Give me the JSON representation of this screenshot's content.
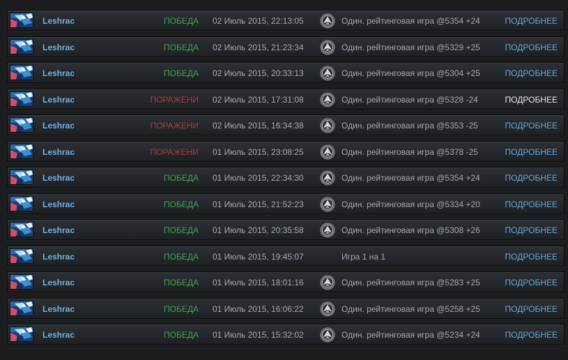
{
  "colors": {
    "win": "#3fa34d",
    "loss": "#b43a34",
    "hero_name": "#6fb2e6",
    "details_link": "#5fa9df",
    "details_link_hover": "#e8e9ea",
    "text_muted": "#a7a9ac"
  },
  "matches": [
    {
      "hero": "Leshrac",
      "hero_icon": "leshrac-portrait-icon",
      "result": "ПОБЕДА",
      "result_type": "win",
      "date": "02 Июль 2015, 22:13:05",
      "mode_icon": "ranked-icon",
      "mode": "Один. рейтинговая игра @5354 +24",
      "details": "ПОДРОБНЕЕ",
      "details_hover": false
    },
    {
      "hero": "Leshrac",
      "hero_icon": "leshrac-portrait-icon",
      "result": "ПОБЕДА",
      "result_type": "win",
      "date": "02 Июль 2015, 21:23:34",
      "mode_icon": "ranked-icon",
      "mode": "Один. рейтинговая игра @5329 +25",
      "details": "ПОДРОБНЕЕ",
      "details_hover": false
    },
    {
      "hero": "Leshrac",
      "hero_icon": "leshrac-portrait-icon",
      "result": "ПОБЕДА",
      "result_type": "win",
      "date": "02 Июль 2015, 20:33:13",
      "mode_icon": "ranked-icon",
      "mode": "Один. рейтинговая игра @5304 +25",
      "details": "ПОДРОБНЕЕ",
      "details_hover": false
    },
    {
      "hero": "Leshrac",
      "hero_icon": "leshrac-portrait-icon",
      "result": "ПОРАЖЕНИ",
      "result_type": "loss",
      "date": "02 Июль 2015, 17:31:08",
      "mode_icon": "ranked-icon",
      "mode": "Один. рейтинговая игра @5328 -24",
      "details": "ПОДРОБНЕЕ",
      "details_hover": true
    },
    {
      "hero": "Leshrac",
      "hero_icon": "leshrac-portrait-icon",
      "result": "ПОРАЖЕНИ",
      "result_type": "loss",
      "date": "02 Июль 2015, 16:34:38",
      "mode_icon": "ranked-icon",
      "mode": "Один. рейтинговая игра @5353 -25",
      "details": "ПОДРОБНЕЕ",
      "details_hover": false
    },
    {
      "hero": "Leshrac",
      "hero_icon": "leshrac-portrait-icon",
      "result": "ПОРАЖЕНИ",
      "result_type": "loss",
      "date": "01 Июль 2015, 23:08:25",
      "mode_icon": "ranked-icon",
      "mode": "Один. рейтинговая игра @5378 -25",
      "details": "ПОДРОБНЕЕ",
      "details_hover": false
    },
    {
      "hero": "Leshrac",
      "hero_icon": "leshrac-portrait-icon",
      "result": "ПОБЕДА",
      "result_type": "win",
      "date": "01 Июль 2015, 22:34:30",
      "mode_icon": "ranked-icon",
      "mode": "Один. рейтинговая игра @5354 +24",
      "details": "ПОДРОБНЕЕ",
      "details_hover": false
    },
    {
      "hero": "Leshrac",
      "hero_icon": "leshrac-portrait-icon",
      "result": "ПОБЕДА",
      "result_type": "win",
      "date": "01 Июль 2015, 21:52:23",
      "mode_icon": "ranked-icon",
      "mode": "Один. рейтинговая игра @5334 +20",
      "details": "ПОДРОБНЕЕ",
      "details_hover": false
    },
    {
      "hero": "Leshrac",
      "hero_icon": "leshrac-portrait-icon",
      "result": "ПОБЕДА",
      "result_type": "win",
      "date": "01 Июль 2015, 20:35:58",
      "mode_icon": "ranked-icon",
      "mode": "Один. рейтинговая игра @5308 +26",
      "details": "ПОДРОБНЕЕ",
      "details_hover": false
    },
    {
      "hero": "Leshrac",
      "hero_icon": "leshrac-portrait-icon",
      "result": "ПОБЕДА",
      "result_type": "win",
      "date": "01 Июль 2015, 19:45:07",
      "mode_icon": "",
      "mode": "Игра 1 на 1",
      "details": "ПОДРОБНЕЕ",
      "details_hover": false
    },
    {
      "hero": "Leshrac",
      "hero_icon": "leshrac-portrait-icon",
      "result": "ПОБЕДА",
      "result_type": "win",
      "date": "01 Июль 2015, 18:01:16",
      "mode_icon": "ranked-icon",
      "mode": "Один. рейтинговая игра @5283 +25",
      "details": "ПОДРОБНЕЕ",
      "details_hover": false
    },
    {
      "hero": "Leshrac",
      "hero_icon": "leshrac-portrait-icon",
      "result": "ПОБЕДА",
      "result_type": "win",
      "date": "01 Июль 2015, 16:06:22",
      "mode_icon": "ranked-icon",
      "mode": "Один. рейтинговая игра @5258 +25",
      "details": "ПОДРОБНЕЕ",
      "details_hover": false
    },
    {
      "hero": "Leshrac",
      "hero_icon": "leshrac-portrait-icon",
      "result": "ПОБЕДА",
      "result_type": "win",
      "date": "01 Июль 2015, 15:32:02",
      "mode_icon": "ranked-icon",
      "mode": "Один. рейтинговая игра @5234 +24",
      "details": "ПОДРОБНЕЕ",
      "details_hover": false
    }
  ]
}
